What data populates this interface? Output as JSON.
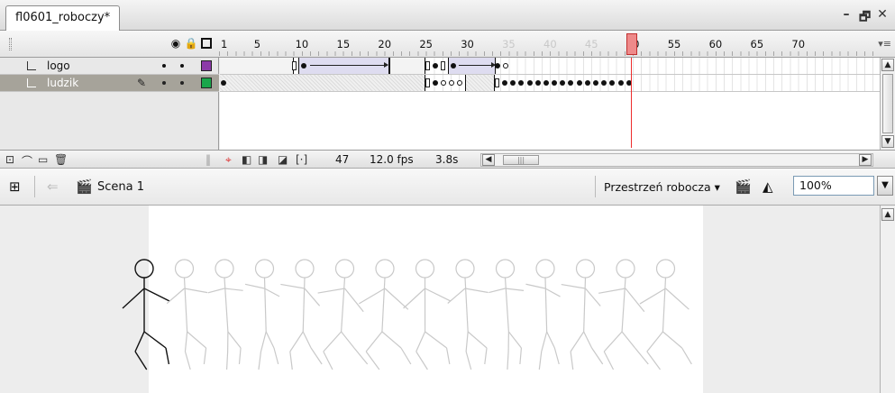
{
  "document": {
    "tab_title": "fl0601_roboczy*"
  },
  "window_controls": {
    "minimize": "–",
    "restore": "🗗",
    "close": "✕"
  },
  "timeline": {
    "frame_numbers": [
      "1",
      "5",
      "10",
      "15",
      "20",
      "25",
      "30",
      "35",
      "40",
      "45",
      "50",
      "55",
      "60",
      "65",
      "70"
    ],
    "dim_frame_numbers": [
      "35",
      "40",
      "45"
    ],
    "current_frame": 47,
    "layers": [
      {
        "name": "logo",
        "color": "#8c3aa8",
        "selected": false
      },
      {
        "name": "ludzik",
        "color": "#19a64a",
        "selected": true
      }
    ],
    "status": {
      "frame": "47",
      "fps": "12.0 fps",
      "time": "3.8s"
    }
  },
  "editbar": {
    "scene_label": "Scena 1",
    "workspace_label": "Przestrzeń robocza ▾",
    "zoom_value": "100%"
  },
  "stage": {
    "figure_count": 14
  }
}
